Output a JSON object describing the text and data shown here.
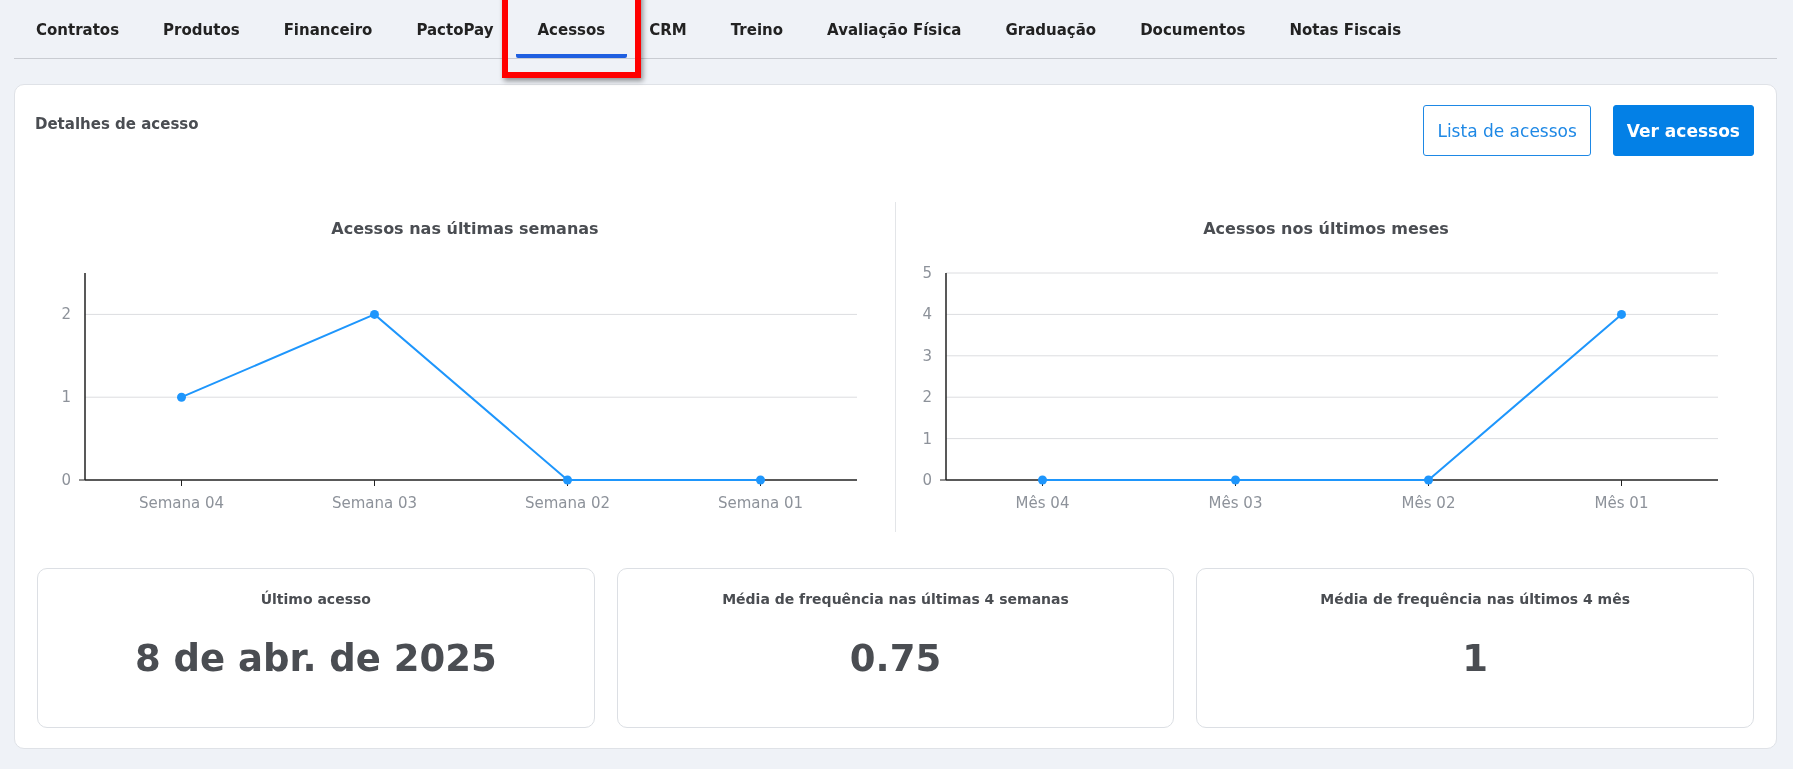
{
  "tabs": [
    {
      "label": "Contratos",
      "selected": false,
      "highlighted": false
    },
    {
      "label": "Produtos",
      "selected": false,
      "highlighted": false
    },
    {
      "label": "Financeiro",
      "selected": false,
      "highlighted": false
    },
    {
      "label": "PactoPay",
      "selected": false,
      "highlighted": false
    },
    {
      "label": "Acessos",
      "selected": true,
      "highlighted": true
    },
    {
      "label": "CRM",
      "selected": false,
      "highlighted": false
    },
    {
      "label": "Treino",
      "selected": false,
      "highlighted": false
    },
    {
      "label": "Avaliação Física",
      "selected": false,
      "highlighted": false
    },
    {
      "label": "Graduação",
      "selected": false,
      "highlighted": false
    },
    {
      "label": "Documentos",
      "selected": false,
      "highlighted": false
    },
    {
      "label": "Notas Fiscais",
      "selected": false,
      "highlighted": false
    }
  ],
  "panel": {
    "title": "Detalhes de acesso",
    "buttons": [
      {
        "label": "Lista de acessos",
        "kind": "outline"
      },
      {
        "label": "Ver acessos",
        "kind": "primary"
      }
    ],
    "charts": [
      {
        "chart_data": {
          "type": "line",
          "title": "Acessos nas últimas semanas",
          "categories": [
            "Semana 04",
            "Semana 03",
            "Semana 02",
            "Semana 01"
          ],
          "grid": true,
          "series": [
            {
              "color": "#1e96fc",
              "marker": true,
              "values": [
                1,
                2,
                0,
                0
              ]
            }
          ],
          "ylim": [
            0,
            2.5
          ],
          "yticks": [
            0,
            1,
            2
          ]
        }
      },
      {
        "chart_data": {
          "type": "line",
          "title": "Acessos nos últimos meses",
          "categories": [
            "Mês 04",
            "Mês 03",
            "Mês 02",
            "Mês 01"
          ],
          "grid": true,
          "series": [
            {
              "color": "#1e96fc",
              "marker": true,
              "values": [
                0,
                0,
                0,
                4
              ]
            }
          ],
          "ylim": [
            0,
            5
          ],
          "yticks": [
            0,
            1,
            2,
            3,
            4,
            5
          ]
        }
      }
    ],
    "stats": [
      {
        "label": "Último acesso",
        "value": "8 de abr. de 2025"
      },
      {
        "label": "Média de frequência nas últimas 4 semanas",
        "value": "0.75"
      },
      {
        "label": "Média de frequência nas últimos 4 mês",
        "value": "1"
      }
    ]
  }
}
